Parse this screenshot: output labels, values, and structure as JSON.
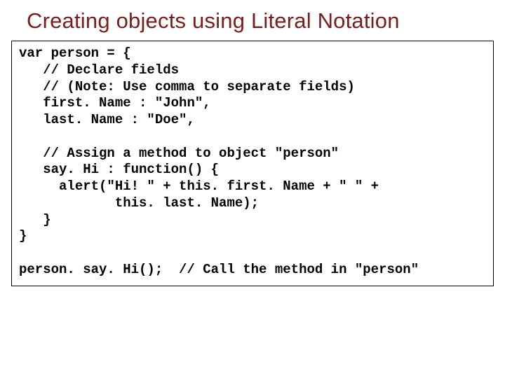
{
  "title": "Creating objects using Literal Notation",
  "code": {
    "l01": "var person = {",
    "l02": "   // Declare fields",
    "l03": "   // (Note: Use comma to separate fields)",
    "l04": "   first. Name : \"John\",",
    "l05": "   last. Name : \"Doe\",",
    "l06": "",
    "l07": "   // Assign a method to object \"person\"",
    "l08": "   say. Hi : function() {",
    "l09": "     alert(\"Hi! \" + this. first. Name + \" \" +",
    "l10": "            this. last. Name);",
    "l11": "   }",
    "l12": "}",
    "l13": "",
    "l14": "person. say. Hi();  // Call the method in \"person\""
  }
}
